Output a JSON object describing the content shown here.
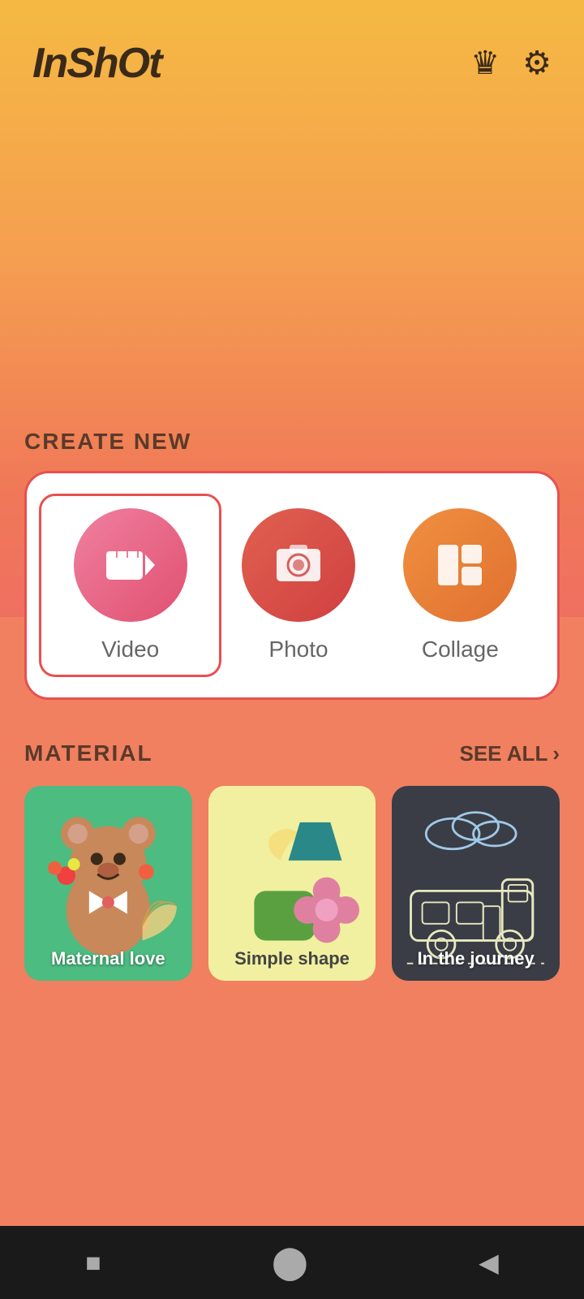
{
  "app": {
    "logo": "InShOt",
    "crown_icon": "♛",
    "settings_icon": "⚙"
  },
  "create_new": {
    "label": "CREATE NEW",
    "items": [
      {
        "id": "video",
        "label": "Video",
        "selected": true
      },
      {
        "id": "photo",
        "label": "Photo",
        "selected": false
      },
      {
        "id": "collage",
        "label": "Collage",
        "selected": false
      }
    ]
  },
  "material": {
    "label": "MATERIAL",
    "see_all": "SEE ALL",
    "chevron": "›",
    "cards": [
      {
        "id": "maternal-love",
        "label": "Maternal love",
        "bg": "#4cbc80"
      },
      {
        "id": "simple-shape",
        "label": "Simple shape",
        "bg": "#f0f0a0"
      },
      {
        "id": "in-the-journey",
        "label": "In the journey",
        "bg": "#3a3d45"
      }
    ]
  },
  "nav": {
    "square": "■",
    "circle": "●",
    "triangle": "◀"
  }
}
